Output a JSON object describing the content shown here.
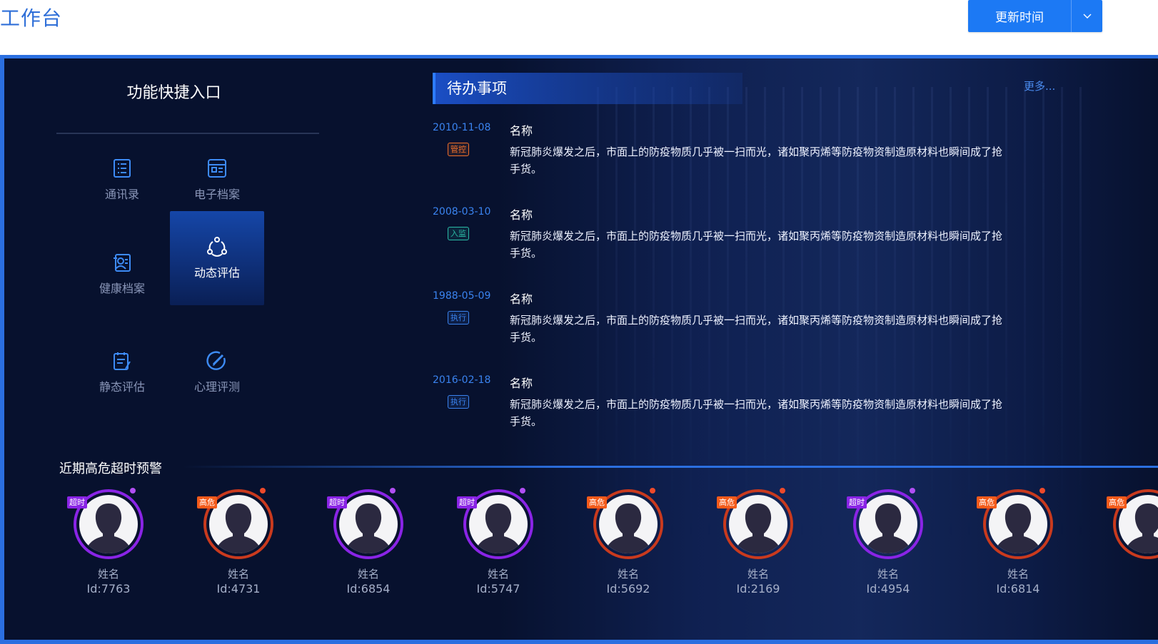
{
  "header": {
    "title": "工作台",
    "update_button_label": "更新时间"
  },
  "quick_access": {
    "title": "功能快捷入口",
    "items": [
      {
        "label": "通讯录",
        "icon": "contacts-list-icon"
      },
      {
        "label": "电子档案",
        "icon": "e-archive-icon"
      },
      {
        "label": "健康档案",
        "icon": "health-record-icon"
      },
      {
        "label": "动态评估",
        "icon": "dynamic-assessment-icon",
        "active": true
      },
      {
        "label": "静态评估",
        "icon": "static-assessment-icon"
      },
      {
        "label": "心理评测",
        "icon": "psychology-test-icon"
      }
    ]
  },
  "todo": {
    "title": "待办事项",
    "more_label": "更多...",
    "items": [
      {
        "date": "2010-11-08",
        "tag": "管控",
        "tag_color": "#f2702a",
        "name": "名称",
        "desc": "新冠肺炎爆发之后，市面上的防疫物质几乎被一扫而光，诸如聚丙烯等防疫物资制造原材料也瞬间成了抢手货。"
      },
      {
        "date": "2008-03-10",
        "tag": "入监",
        "tag_color": "#2bbba6",
        "name": "名称",
        "desc": "新冠肺炎爆发之后，市面上的防疫物质几乎被一扫而光，诸如聚丙烯等防疫物资制造原材料也瞬间成了抢手货。"
      },
      {
        "date": "1988-05-09",
        "tag": "执行",
        "tag_color": "#3a83ef",
        "name": "名称",
        "desc": "新冠肺炎爆发之后，市面上的防疫物质几乎被一扫而光，诸如聚丙烯等防疫物资制造原材料也瞬间成了抢手货。"
      },
      {
        "date": "2016-02-18",
        "tag": "执行",
        "tag_color": "#3a83ef",
        "name": "名称",
        "desc": "新冠肺炎爆发之后，市面上的防疫物质几乎被一扫而光，诸如聚丙烯等防疫物资制造原材料也瞬间成了抢手货。"
      }
    ]
  },
  "warnings": {
    "title": "近期高危超时预警",
    "people": [
      {
        "badge": "超时",
        "name": "姓名",
        "id": "Id:7763"
      },
      {
        "badge": "高危",
        "name": "姓名",
        "id": "Id:4731"
      },
      {
        "badge": "超时",
        "name": "姓名",
        "id": "Id:6854"
      },
      {
        "badge": "超时",
        "name": "姓名",
        "id": "Id:5747"
      },
      {
        "badge": "高危",
        "name": "姓名",
        "id": "Id:5692"
      },
      {
        "badge": "高危",
        "name": "姓名",
        "id": "Id:2169"
      },
      {
        "badge": "超时",
        "name": "姓名",
        "id": "Id:4954"
      },
      {
        "badge": "高危",
        "name": "姓名",
        "id": "Id:6814"
      },
      {
        "badge": "高危"
      }
    ]
  },
  "colors": {
    "accent": "#1c79f4",
    "panel_bg": "#07112e",
    "timeout": "#8a24e6",
    "high_risk": "#f45a1a"
  }
}
